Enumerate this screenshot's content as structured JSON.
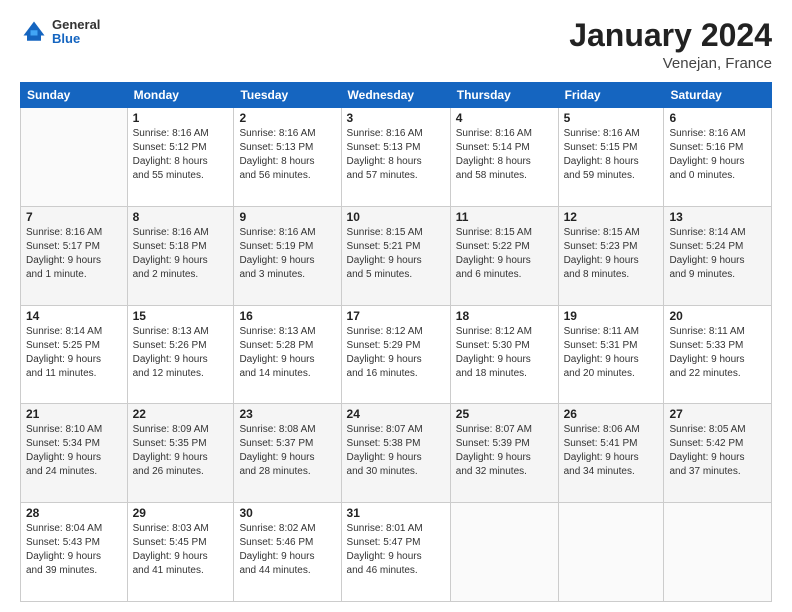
{
  "header": {
    "logo_general": "General",
    "logo_blue": "Blue",
    "month_year": "January 2024",
    "location": "Venejan, France"
  },
  "weekdays": [
    "Sunday",
    "Monday",
    "Tuesday",
    "Wednesday",
    "Thursday",
    "Friday",
    "Saturday"
  ],
  "weeks": [
    [
      {
        "day": "",
        "info": ""
      },
      {
        "day": "1",
        "info": "Sunrise: 8:16 AM\nSunset: 5:12 PM\nDaylight: 8 hours\nand 55 minutes."
      },
      {
        "day": "2",
        "info": "Sunrise: 8:16 AM\nSunset: 5:13 PM\nDaylight: 8 hours\nand 56 minutes."
      },
      {
        "day": "3",
        "info": "Sunrise: 8:16 AM\nSunset: 5:13 PM\nDaylight: 8 hours\nand 57 minutes."
      },
      {
        "day": "4",
        "info": "Sunrise: 8:16 AM\nSunset: 5:14 PM\nDaylight: 8 hours\nand 58 minutes."
      },
      {
        "day": "5",
        "info": "Sunrise: 8:16 AM\nSunset: 5:15 PM\nDaylight: 8 hours\nand 59 minutes."
      },
      {
        "day": "6",
        "info": "Sunrise: 8:16 AM\nSunset: 5:16 PM\nDaylight: 9 hours\nand 0 minutes."
      }
    ],
    [
      {
        "day": "7",
        "info": "Sunrise: 8:16 AM\nSunset: 5:17 PM\nDaylight: 9 hours\nand 1 minute."
      },
      {
        "day": "8",
        "info": "Sunrise: 8:16 AM\nSunset: 5:18 PM\nDaylight: 9 hours\nand 2 minutes."
      },
      {
        "day": "9",
        "info": "Sunrise: 8:16 AM\nSunset: 5:19 PM\nDaylight: 9 hours\nand 3 minutes."
      },
      {
        "day": "10",
        "info": "Sunrise: 8:15 AM\nSunset: 5:21 PM\nDaylight: 9 hours\nand 5 minutes."
      },
      {
        "day": "11",
        "info": "Sunrise: 8:15 AM\nSunset: 5:22 PM\nDaylight: 9 hours\nand 6 minutes."
      },
      {
        "day": "12",
        "info": "Sunrise: 8:15 AM\nSunset: 5:23 PM\nDaylight: 9 hours\nand 8 minutes."
      },
      {
        "day": "13",
        "info": "Sunrise: 8:14 AM\nSunset: 5:24 PM\nDaylight: 9 hours\nand 9 minutes."
      }
    ],
    [
      {
        "day": "14",
        "info": "Sunrise: 8:14 AM\nSunset: 5:25 PM\nDaylight: 9 hours\nand 11 minutes."
      },
      {
        "day": "15",
        "info": "Sunrise: 8:13 AM\nSunset: 5:26 PM\nDaylight: 9 hours\nand 12 minutes."
      },
      {
        "day": "16",
        "info": "Sunrise: 8:13 AM\nSunset: 5:28 PM\nDaylight: 9 hours\nand 14 minutes."
      },
      {
        "day": "17",
        "info": "Sunrise: 8:12 AM\nSunset: 5:29 PM\nDaylight: 9 hours\nand 16 minutes."
      },
      {
        "day": "18",
        "info": "Sunrise: 8:12 AM\nSunset: 5:30 PM\nDaylight: 9 hours\nand 18 minutes."
      },
      {
        "day": "19",
        "info": "Sunrise: 8:11 AM\nSunset: 5:31 PM\nDaylight: 9 hours\nand 20 minutes."
      },
      {
        "day": "20",
        "info": "Sunrise: 8:11 AM\nSunset: 5:33 PM\nDaylight: 9 hours\nand 22 minutes."
      }
    ],
    [
      {
        "day": "21",
        "info": "Sunrise: 8:10 AM\nSunset: 5:34 PM\nDaylight: 9 hours\nand 24 minutes."
      },
      {
        "day": "22",
        "info": "Sunrise: 8:09 AM\nSunset: 5:35 PM\nDaylight: 9 hours\nand 26 minutes."
      },
      {
        "day": "23",
        "info": "Sunrise: 8:08 AM\nSunset: 5:37 PM\nDaylight: 9 hours\nand 28 minutes."
      },
      {
        "day": "24",
        "info": "Sunrise: 8:07 AM\nSunset: 5:38 PM\nDaylight: 9 hours\nand 30 minutes."
      },
      {
        "day": "25",
        "info": "Sunrise: 8:07 AM\nSunset: 5:39 PM\nDaylight: 9 hours\nand 32 minutes."
      },
      {
        "day": "26",
        "info": "Sunrise: 8:06 AM\nSunset: 5:41 PM\nDaylight: 9 hours\nand 34 minutes."
      },
      {
        "day": "27",
        "info": "Sunrise: 8:05 AM\nSunset: 5:42 PM\nDaylight: 9 hours\nand 37 minutes."
      }
    ],
    [
      {
        "day": "28",
        "info": "Sunrise: 8:04 AM\nSunset: 5:43 PM\nDaylight: 9 hours\nand 39 minutes."
      },
      {
        "day": "29",
        "info": "Sunrise: 8:03 AM\nSunset: 5:45 PM\nDaylight: 9 hours\nand 41 minutes."
      },
      {
        "day": "30",
        "info": "Sunrise: 8:02 AM\nSunset: 5:46 PM\nDaylight: 9 hours\nand 44 minutes."
      },
      {
        "day": "31",
        "info": "Sunrise: 8:01 AM\nSunset: 5:47 PM\nDaylight: 9 hours\nand 46 minutes."
      },
      {
        "day": "",
        "info": ""
      },
      {
        "day": "",
        "info": ""
      },
      {
        "day": "",
        "info": ""
      }
    ]
  ]
}
